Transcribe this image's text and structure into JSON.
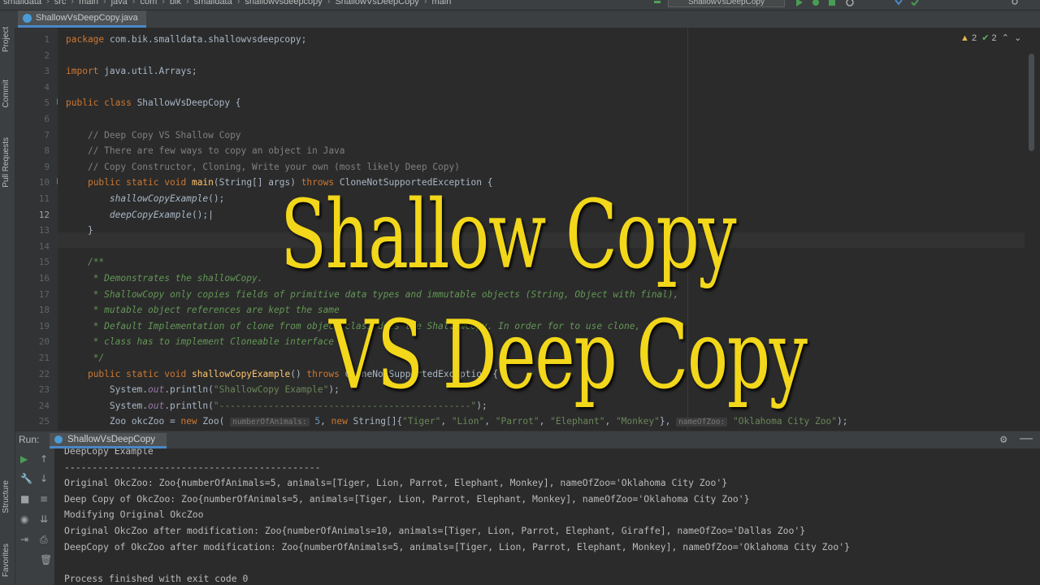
{
  "topbar": {
    "crumbs": [
      "smalldata",
      "src",
      "main",
      "java",
      "com",
      "bik",
      "smalldata",
      "shallowvsdeepcopy",
      "ShallowVsDeepCopy",
      "main"
    ],
    "run_config": "ShallowVsDeepCopy"
  },
  "editor": {
    "tab_label": "ShallowVsDeepCopy.java",
    "inspections": {
      "warnings": "2",
      "ok": "2"
    },
    "current_line": "12"
  },
  "left_strip": [
    "Project",
    "Commit",
    "Pull Requests",
    "Structure",
    "Favorites"
  ],
  "code": [
    {
      "ln": "1",
      "html": "<span class='kw'>package</span> com.bik.smalldata.shallowvsdeepcopy;"
    },
    {
      "ln": "2",
      "html": ""
    },
    {
      "ln": "3",
      "html": "<span class='kw'>import</span> java.util.Arrays;"
    },
    {
      "ln": "4",
      "html": ""
    },
    {
      "ln": "5",
      "html": "<span class='kw'>public class</span> ShallowVsDeepCopy {"
    },
    {
      "ln": "6",
      "html": ""
    },
    {
      "ln": "7",
      "html": "    <span class='cm'>// Deep Copy VS Shallow Copy</span>"
    },
    {
      "ln": "8",
      "html": "    <span class='cm'>// There are few ways to copy an object in Java</span>"
    },
    {
      "ln": "9",
      "html": "    <span class='cm'>// Copy Constructor, Cloning, Write your own (most likely Deep Copy)</span>"
    },
    {
      "ln": "10",
      "html": "    <span class='kw'>public static void</span> <span class='fn'>main</span>(String[] args) <span class='kw'>throws</span> CloneNotSupportedException {"
    },
    {
      "ln": "11",
      "html": "        <span class='sm'>shallowCopyExample</span>();"
    },
    {
      "ln": "12",
      "html": "        <span class='sm'>deepCopyExample</span>();|"
    },
    {
      "ln": "13",
      "html": "    }"
    },
    {
      "ln": "14",
      "html": ""
    },
    {
      "ln": "15",
      "html": "    <span class='dc'>/**</span>"
    },
    {
      "ln": "16",
      "html": "<span class='dc'>     * Demonstrates the shallowCopy.</span>"
    },
    {
      "ln": "17",
      "html": "<span class='dc'>     * ShallowCopy only copies fields of primitive data types and immutable objects (String, Object with final),</span>"
    },
    {
      "ln": "18",
      "html": "<span class='dc'>     * mutable object references are kept the same</span>"
    },
    {
      "ln": "19",
      "html": "<span class='dc'>     * Default Implementation of clone from object class does the ShallowCopy. In order for to use clone,</span>"
    },
    {
      "ln": "20",
      "html": "<span class='dc'>     * class has to implement Cloneable interface</span>"
    },
    {
      "ln": "21",
      "html": "<span class='dc'>     */</span>"
    },
    {
      "ln": "22",
      "html": "    <span class='kw'>public static void</span> <span class='fn'>shallowCopyExample</span>() <span class='kw'>throws</span> CloneNotSupportedException {"
    },
    {
      "ln": "23",
      "html": "        System.<span class='it'>out</span>.println(<span class='st'>\"ShallowCopy Example\"</span>);"
    },
    {
      "ln": "24",
      "html": "        System.<span class='it'>out</span>.println(<span class='st'>\"----------------------------------------------\"</span>);"
    },
    {
      "ln": "25",
      "html": "        Zoo okcZoo = <span class='kw'>new</span> Zoo( <span class='hint'>numberOfAnimals:</span> <span class='num'>5</span>, <span class='kw'>new</span> String[]{<span class='st'>\"Tiger\"</span>, <span class='st'>\"Lion\"</span>, <span class='st'>\"Parrot\"</span>, <span class='st'>\"Elephant\"</span>, <span class='st'>\"Monkey\"</span>}, <span class='hint'>nameOfZoo:</span> <span class='st'>\"Oklahoma City Zoo\"</span>);"
    }
  ],
  "overlay": {
    "line1": "Shallow Copy",
    "line2": "VS Deep Copy",
    "color": "#f2d71a"
  },
  "run_panel": {
    "label": "Run:",
    "tab_label": "ShallowVsDeepCopy",
    "output": [
      "DeepCopy Example",
      "----------------------------------------------",
      "Original OkcZoo: Zoo{numberOfAnimals=5, animals=[Tiger, Lion, Parrot, Elephant, Monkey], nameOfZoo='Oklahoma City Zoo'}",
      "Deep Copy of OkcZoo: Zoo{numberOfAnimals=5, animals=[Tiger, Lion, Parrot, Elephant, Monkey], nameOfZoo='Oklahoma City Zoo'}",
      "Modifying Original OkcZoo",
      "Original OkcZoo after modification: Zoo{numberOfAnimals=10, animals=[Tiger, Lion, Parrot, Elephant, Giraffe], nameOfZoo='Dallas Zoo'}",
      "DeepCopy of OkcZoo after modification: Zoo{numberOfAnimals=5, animals=[Tiger, Lion, Parrot, Elephant, Monkey], nameOfZoo='Oklahoma City Zoo'}",
      "",
      "Process finished with exit code 0"
    ]
  }
}
